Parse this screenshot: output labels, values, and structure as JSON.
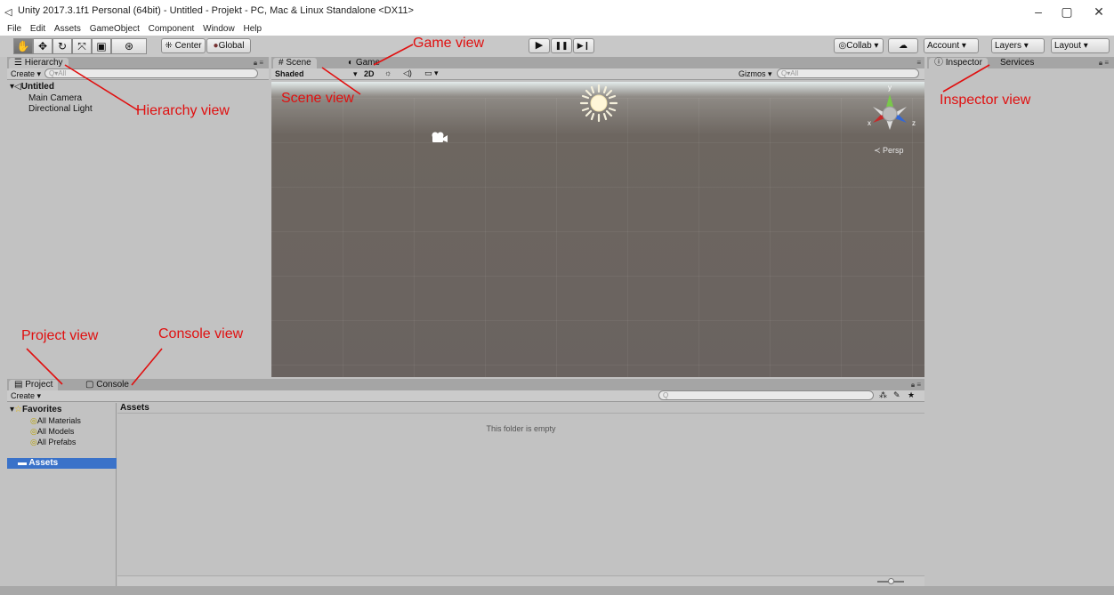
{
  "window": {
    "title": "Unity 2017.3.1f1 Personal (64bit) - Untitled - Projekt - PC, Mac & Linux Standalone <DX11>",
    "minimize": "–",
    "maximize": "▢",
    "close": "✕"
  },
  "menu": [
    "File",
    "Edit",
    "Assets",
    "GameObject",
    "Component",
    "Window",
    "Help"
  ],
  "toolbar": {
    "pivot": "Center",
    "space": "Global",
    "play": "▶",
    "pause": "❚❚",
    "step": "▶❙",
    "collab": "Collab ▾",
    "cloud": "☁",
    "account": "Account ▾",
    "layers": "Layers ▾",
    "layout": "Layout ▾"
  },
  "hierarchy": {
    "tab": "Hierarchy",
    "create": "Create ▾",
    "search_placeholder": "Q▾All",
    "scene": "Untitled",
    "items": [
      "Main Camera",
      "Directional Light"
    ]
  },
  "scene": {
    "tab_scene": "Scene",
    "tab_game": "Game",
    "shading": "Shaded",
    "mode2d": "2D",
    "gizmos": "Gizmos ▾",
    "search_placeholder": "Q▾All",
    "persp": "≺ Persp",
    "axis_y": "y",
    "axis_x": "x",
    "axis_z": "z"
  },
  "inspector": {
    "tab": "Inspector",
    "services": "Services"
  },
  "project": {
    "tab": "Project",
    "console": "Console",
    "create": "Create ▾",
    "favorites": "Favorites",
    "fav_items": [
      "All Materials",
      "All Models",
      "All Prefabs"
    ],
    "assets": "Assets",
    "assets_header": "Assets",
    "empty": "This folder is empty"
  },
  "annotations": {
    "game_view": "Game view",
    "hierarchy_view": "Hierarchy view",
    "scene_view": "Scene view",
    "inspector_view": "Inspector view",
    "project_view": "Project view",
    "console_view": "Console view"
  },
  "colors": {
    "annotation": "#e01010",
    "selection": "#3a72c9",
    "panel": "#c2c2c2"
  }
}
